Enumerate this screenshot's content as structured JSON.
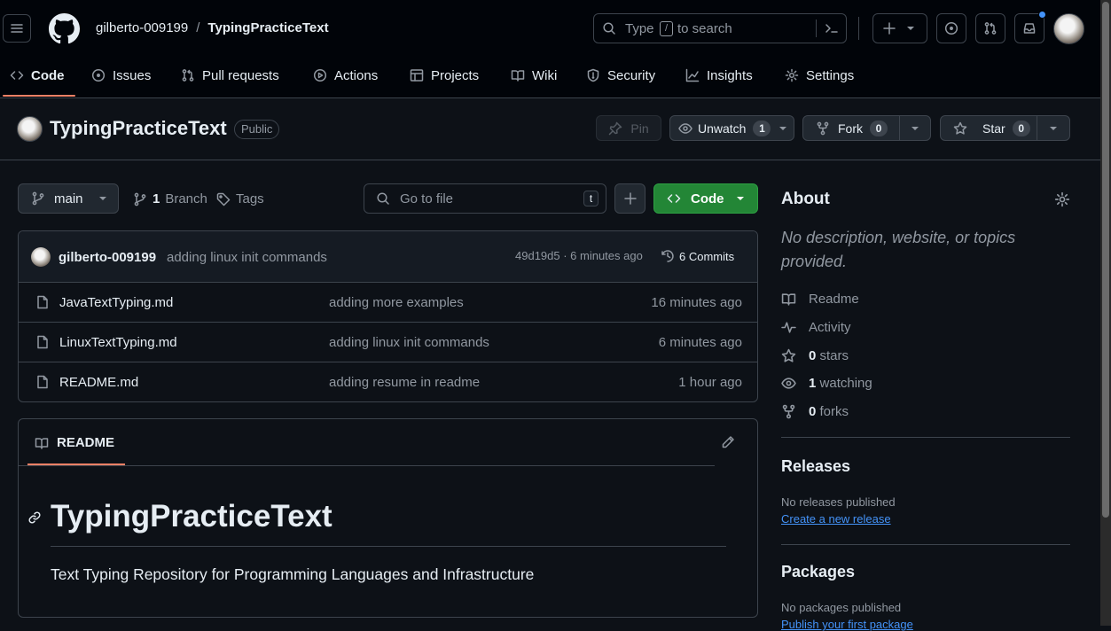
{
  "header": {
    "owner": "gilberto-009199",
    "separator": "/",
    "repo": "TypingPracticeText",
    "search": {
      "prefix": "Type",
      "key": "/",
      "suffix": "to search"
    }
  },
  "tabs": [
    {
      "label": "Code",
      "icon": "code-icon",
      "active": true
    },
    {
      "label": "Issues",
      "icon": "issue-opened-icon"
    },
    {
      "label": "Pull requests",
      "icon": "git-pull-request-icon"
    },
    {
      "label": "Actions",
      "icon": "play-icon"
    },
    {
      "label": "Projects",
      "icon": "table-icon"
    },
    {
      "label": "Wiki",
      "icon": "book-icon"
    },
    {
      "label": "Security",
      "icon": "shield-icon"
    },
    {
      "label": "Insights",
      "icon": "graph-icon"
    },
    {
      "label": "Settings",
      "icon": "gear-icon"
    }
  ],
  "repo_header": {
    "name": "TypingPracticeText",
    "visibility": "Public",
    "pin_label": "Pin",
    "unwatch_label": "Unwatch",
    "unwatch_count": "1",
    "fork_label": "Fork",
    "fork_count": "0",
    "star_label": "Star",
    "star_count": "0"
  },
  "branch_bar": {
    "branch": "main",
    "branch_count": "1",
    "branch_label": "Branch",
    "tags_label": "Tags",
    "goto_placeholder": "Go to file",
    "goto_key": "t",
    "code_button": "Code"
  },
  "latest_commit": {
    "author": "gilberto-009199",
    "message": "adding linux init commands",
    "hash_time": "49d19d5 · 6 minutes ago",
    "commits_label": "6 Commits"
  },
  "files": [
    {
      "name": "JavaTextTyping.md",
      "message": "adding more examples",
      "age": "16 minutes ago"
    },
    {
      "name": "LinuxTextTyping.md",
      "message": "adding linux init commands",
      "age": "6 minutes ago"
    },
    {
      "name": "README.md",
      "message": "adding resume in readme",
      "age": "1 hour ago"
    }
  ],
  "readme": {
    "tab_label": "README",
    "title": "TypingPracticeText",
    "body": "Text Typing Repository for Programming Languages and Infrastructure"
  },
  "about": {
    "heading": "About",
    "description": "No description, website, or topics provided.",
    "readme": "Readme",
    "activity": "Activity",
    "stars_count": "0",
    "stars_label": "stars",
    "watching_count": "1",
    "watching_label": "watching",
    "forks_count": "0",
    "forks_label": "forks"
  },
  "releases": {
    "heading": "Releases",
    "none": "No releases published",
    "link": "Create a new release"
  },
  "packages": {
    "heading": "Packages",
    "none": "No packages published",
    "link": "Publish your first package"
  },
  "colors": {
    "accent": "#f78166",
    "green": "#238636",
    "link": "#4493f8",
    "notification": "#4493f8"
  }
}
